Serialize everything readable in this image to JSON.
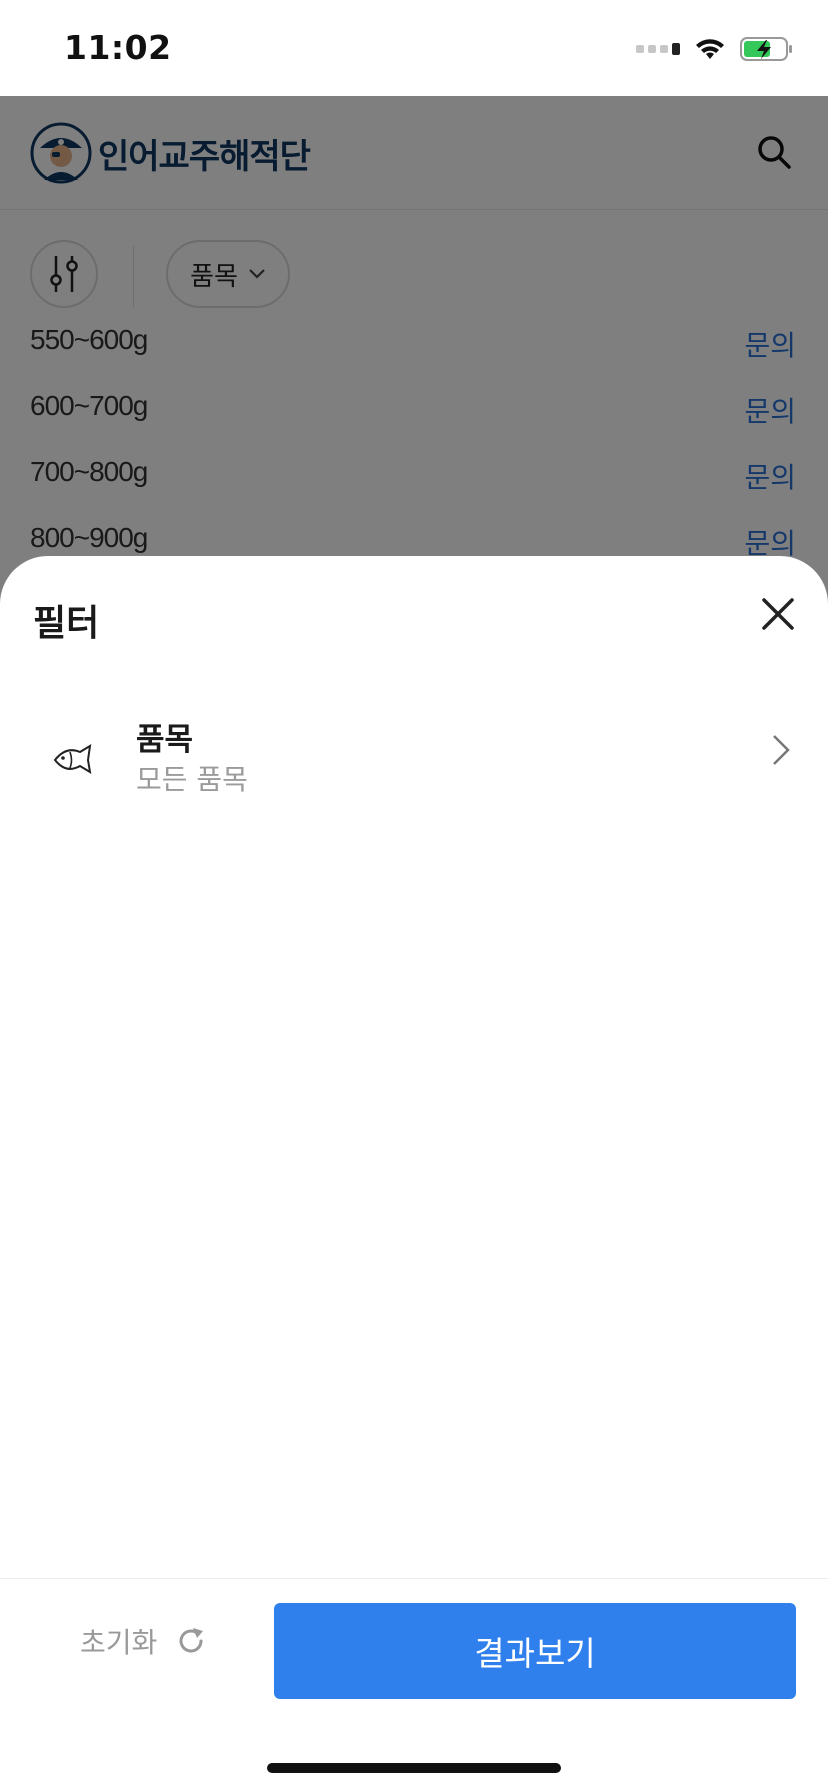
{
  "status_bar": {
    "time": "11:02"
  },
  "app": {
    "brand": "인어교주해적단",
    "filter_chip": "품목",
    "price_rows": [
      {
        "weight": "550~600g",
        "inquiry": "문의"
      },
      {
        "weight": "600~700g",
        "inquiry": "문의"
      },
      {
        "weight": "700~800g",
        "inquiry": "문의"
      },
      {
        "weight": "800~900g",
        "inquiry": "문의"
      }
    ]
  },
  "sheet": {
    "title": "필터",
    "option": {
      "title": "품목",
      "value": "모든 품목"
    },
    "reset_label": "초기화",
    "result_label": "결과보기"
  },
  "colors": {
    "primary": "#2f80ed",
    "brand_navy": "#0e3763",
    "inquiry_blue": "#2a70d6"
  },
  "icons": [
    "wifi-icon",
    "battery-icon",
    "search-icon",
    "sliders-icon",
    "chevron-down-icon",
    "close-icon",
    "fish-icon",
    "chevron-right-icon",
    "refresh-icon"
  ]
}
